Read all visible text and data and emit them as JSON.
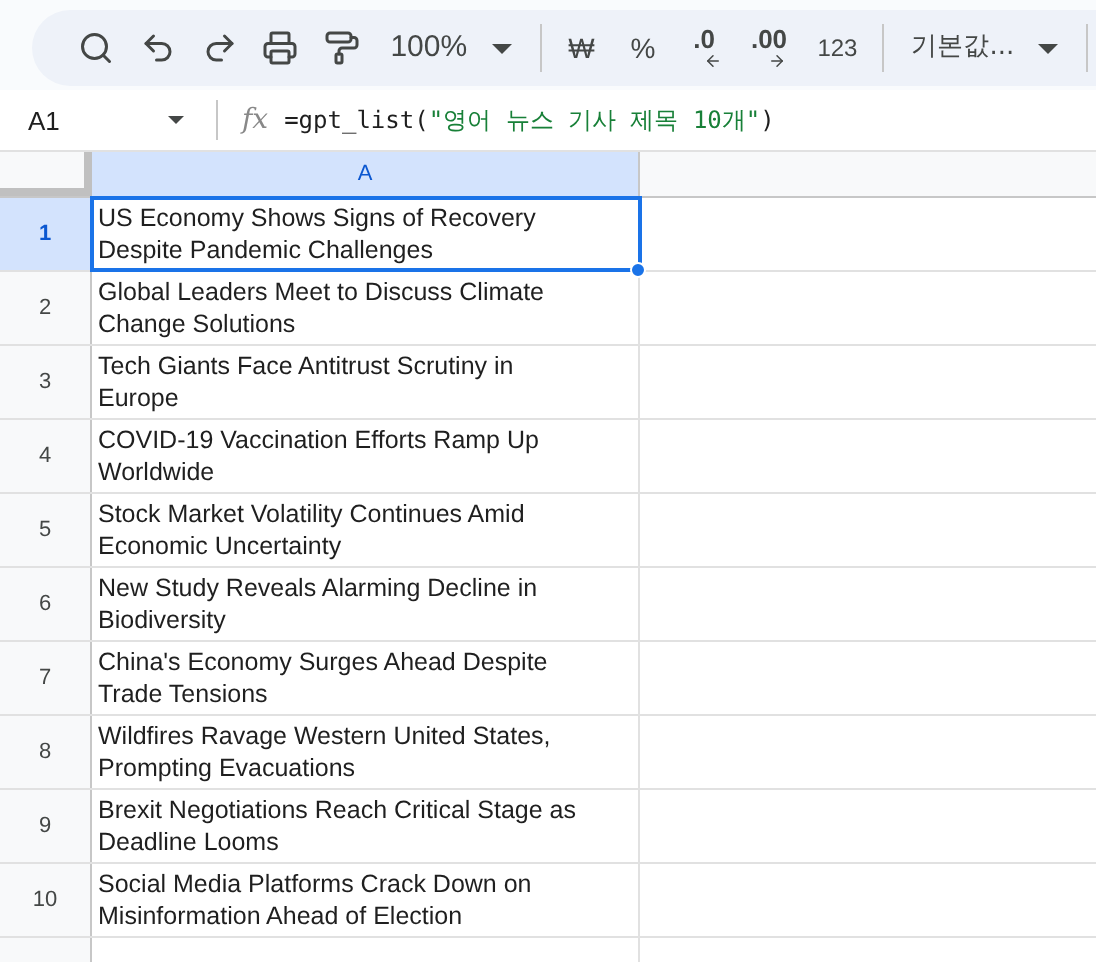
{
  "toolbar": {
    "zoom": "100%",
    "currency": "₩",
    "percent": "%",
    "decrease_decimal": ".0",
    "increase_decimal": ".00",
    "number_format": "123",
    "font": "기본값..."
  },
  "formula_bar": {
    "cell_ref": "A1",
    "fx": "fx",
    "formula_prefix": "=gpt_list(",
    "formula_string": "\"영어 뉴스 기사 제목 10개\"",
    "formula_suffix": ")"
  },
  "columns": [
    {
      "label": "A",
      "selected": true
    }
  ],
  "rows": [
    {
      "number": "1",
      "cell": "US Economy Shows Signs of Recovery Despite Pandemic Challenges",
      "selected": true
    },
    {
      "number": "2",
      "cell": "Global Leaders Meet to Discuss Climate Change Solutions",
      "selected": false
    },
    {
      "number": "3",
      "cell": "Tech Giants Face Antitrust Scrutiny in Europe",
      "selected": false
    },
    {
      "number": "4",
      "cell": "COVID-19 Vaccination Efforts Ramp Up Worldwide",
      "selected": false
    },
    {
      "number": "5",
      "cell": "Stock Market Volatility Continues Amid Economic Uncertainty",
      "selected": false
    },
    {
      "number": "6",
      "cell": "New Study Reveals Alarming Decline in Biodiversity",
      "selected": false
    },
    {
      "number": "7",
      "cell": "China's Economy Surges Ahead Despite Trade Tensions",
      "selected": false
    },
    {
      "number": "8",
      "cell": "Wildfires Ravage Western United States, Prompting Evacuations",
      "selected": false
    },
    {
      "number": "9",
      "cell": "Brexit Negotiations Reach Critical Stage as Deadline Looms",
      "selected": false
    },
    {
      "number": "10",
      "cell": "Social Media Platforms Crack Down on Misinformation Ahead of Election",
      "selected": false
    }
  ]
}
